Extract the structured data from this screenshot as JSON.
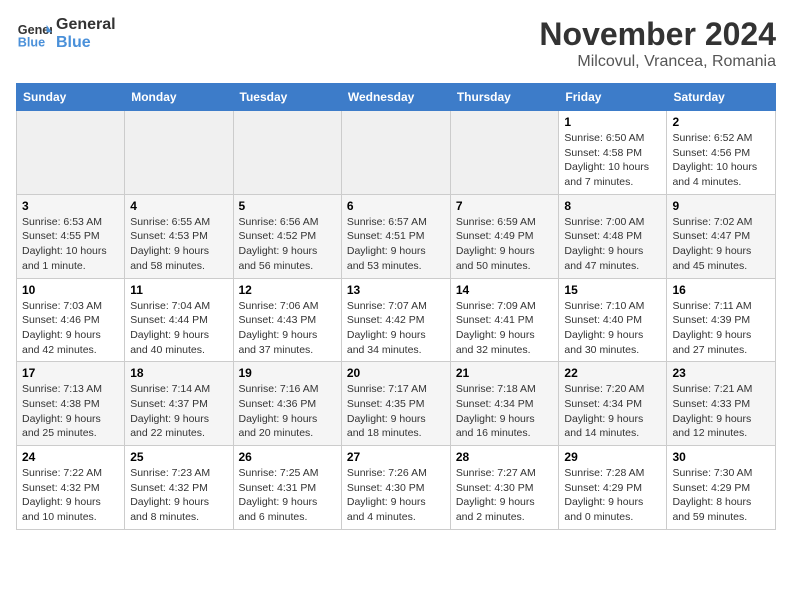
{
  "header": {
    "logo_line1": "General",
    "logo_line2": "Blue",
    "month": "November 2024",
    "location": "Milcovul, Vrancea, Romania"
  },
  "weekdays": [
    "Sunday",
    "Monday",
    "Tuesday",
    "Wednesday",
    "Thursday",
    "Friday",
    "Saturday"
  ],
  "weeks": [
    [
      {
        "day": "",
        "info": ""
      },
      {
        "day": "",
        "info": ""
      },
      {
        "day": "",
        "info": ""
      },
      {
        "day": "",
        "info": ""
      },
      {
        "day": "",
        "info": ""
      },
      {
        "day": "1",
        "info": "Sunrise: 6:50 AM\nSunset: 4:58 PM\nDaylight: 10 hours and 7 minutes."
      },
      {
        "day": "2",
        "info": "Sunrise: 6:52 AM\nSunset: 4:56 PM\nDaylight: 10 hours and 4 minutes."
      }
    ],
    [
      {
        "day": "3",
        "info": "Sunrise: 6:53 AM\nSunset: 4:55 PM\nDaylight: 10 hours and 1 minute."
      },
      {
        "day": "4",
        "info": "Sunrise: 6:55 AM\nSunset: 4:53 PM\nDaylight: 9 hours and 58 minutes."
      },
      {
        "day": "5",
        "info": "Sunrise: 6:56 AM\nSunset: 4:52 PM\nDaylight: 9 hours and 56 minutes."
      },
      {
        "day": "6",
        "info": "Sunrise: 6:57 AM\nSunset: 4:51 PM\nDaylight: 9 hours and 53 minutes."
      },
      {
        "day": "7",
        "info": "Sunrise: 6:59 AM\nSunset: 4:49 PM\nDaylight: 9 hours and 50 minutes."
      },
      {
        "day": "8",
        "info": "Sunrise: 7:00 AM\nSunset: 4:48 PM\nDaylight: 9 hours and 47 minutes."
      },
      {
        "day": "9",
        "info": "Sunrise: 7:02 AM\nSunset: 4:47 PM\nDaylight: 9 hours and 45 minutes."
      }
    ],
    [
      {
        "day": "10",
        "info": "Sunrise: 7:03 AM\nSunset: 4:46 PM\nDaylight: 9 hours and 42 minutes."
      },
      {
        "day": "11",
        "info": "Sunrise: 7:04 AM\nSunset: 4:44 PM\nDaylight: 9 hours and 40 minutes."
      },
      {
        "day": "12",
        "info": "Sunrise: 7:06 AM\nSunset: 4:43 PM\nDaylight: 9 hours and 37 minutes."
      },
      {
        "day": "13",
        "info": "Sunrise: 7:07 AM\nSunset: 4:42 PM\nDaylight: 9 hours and 34 minutes."
      },
      {
        "day": "14",
        "info": "Sunrise: 7:09 AM\nSunset: 4:41 PM\nDaylight: 9 hours and 32 minutes."
      },
      {
        "day": "15",
        "info": "Sunrise: 7:10 AM\nSunset: 4:40 PM\nDaylight: 9 hours and 30 minutes."
      },
      {
        "day": "16",
        "info": "Sunrise: 7:11 AM\nSunset: 4:39 PM\nDaylight: 9 hours and 27 minutes."
      }
    ],
    [
      {
        "day": "17",
        "info": "Sunrise: 7:13 AM\nSunset: 4:38 PM\nDaylight: 9 hours and 25 minutes."
      },
      {
        "day": "18",
        "info": "Sunrise: 7:14 AM\nSunset: 4:37 PM\nDaylight: 9 hours and 22 minutes."
      },
      {
        "day": "19",
        "info": "Sunrise: 7:16 AM\nSunset: 4:36 PM\nDaylight: 9 hours and 20 minutes."
      },
      {
        "day": "20",
        "info": "Sunrise: 7:17 AM\nSunset: 4:35 PM\nDaylight: 9 hours and 18 minutes."
      },
      {
        "day": "21",
        "info": "Sunrise: 7:18 AM\nSunset: 4:34 PM\nDaylight: 9 hours and 16 minutes."
      },
      {
        "day": "22",
        "info": "Sunrise: 7:20 AM\nSunset: 4:34 PM\nDaylight: 9 hours and 14 minutes."
      },
      {
        "day": "23",
        "info": "Sunrise: 7:21 AM\nSunset: 4:33 PM\nDaylight: 9 hours and 12 minutes."
      }
    ],
    [
      {
        "day": "24",
        "info": "Sunrise: 7:22 AM\nSunset: 4:32 PM\nDaylight: 9 hours and 10 minutes."
      },
      {
        "day": "25",
        "info": "Sunrise: 7:23 AM\nSunset: 4:32 PM\nDaylight: 9 hours and 8 minutes."
      },
      {
        "day": "26",
        "info": "Sunrise: 7:25 AM\nSunset: 4:31 PM\nDaylight: 9 hours and 6 minutes."
      },
      {
        "day": "27",
        "info": "Sunrise: 7:26 AM\nSunset: 4:30 PM\nDaylight: 9 hours and 4 minutes."
      },
      {
        "day": "28",
        "info": "Sunrise: 7:27 AM\nSunset: 4:30 PM\nDaylight: 9 hours and 2 minutes."
      },
      {
        "day": "29",
        "info": "Sunrise: 7:28 AM\nSunset: 4:29 PM\nDaylight: 9 hours and 0 minutes."
      },
      {
        "day": "30",
        "info": "Sunrise: 7:30 AM\nSunset: 4:29 PM\nDaylight: 8 hours and 59 minutes."
      }
    ]
  ]
}
